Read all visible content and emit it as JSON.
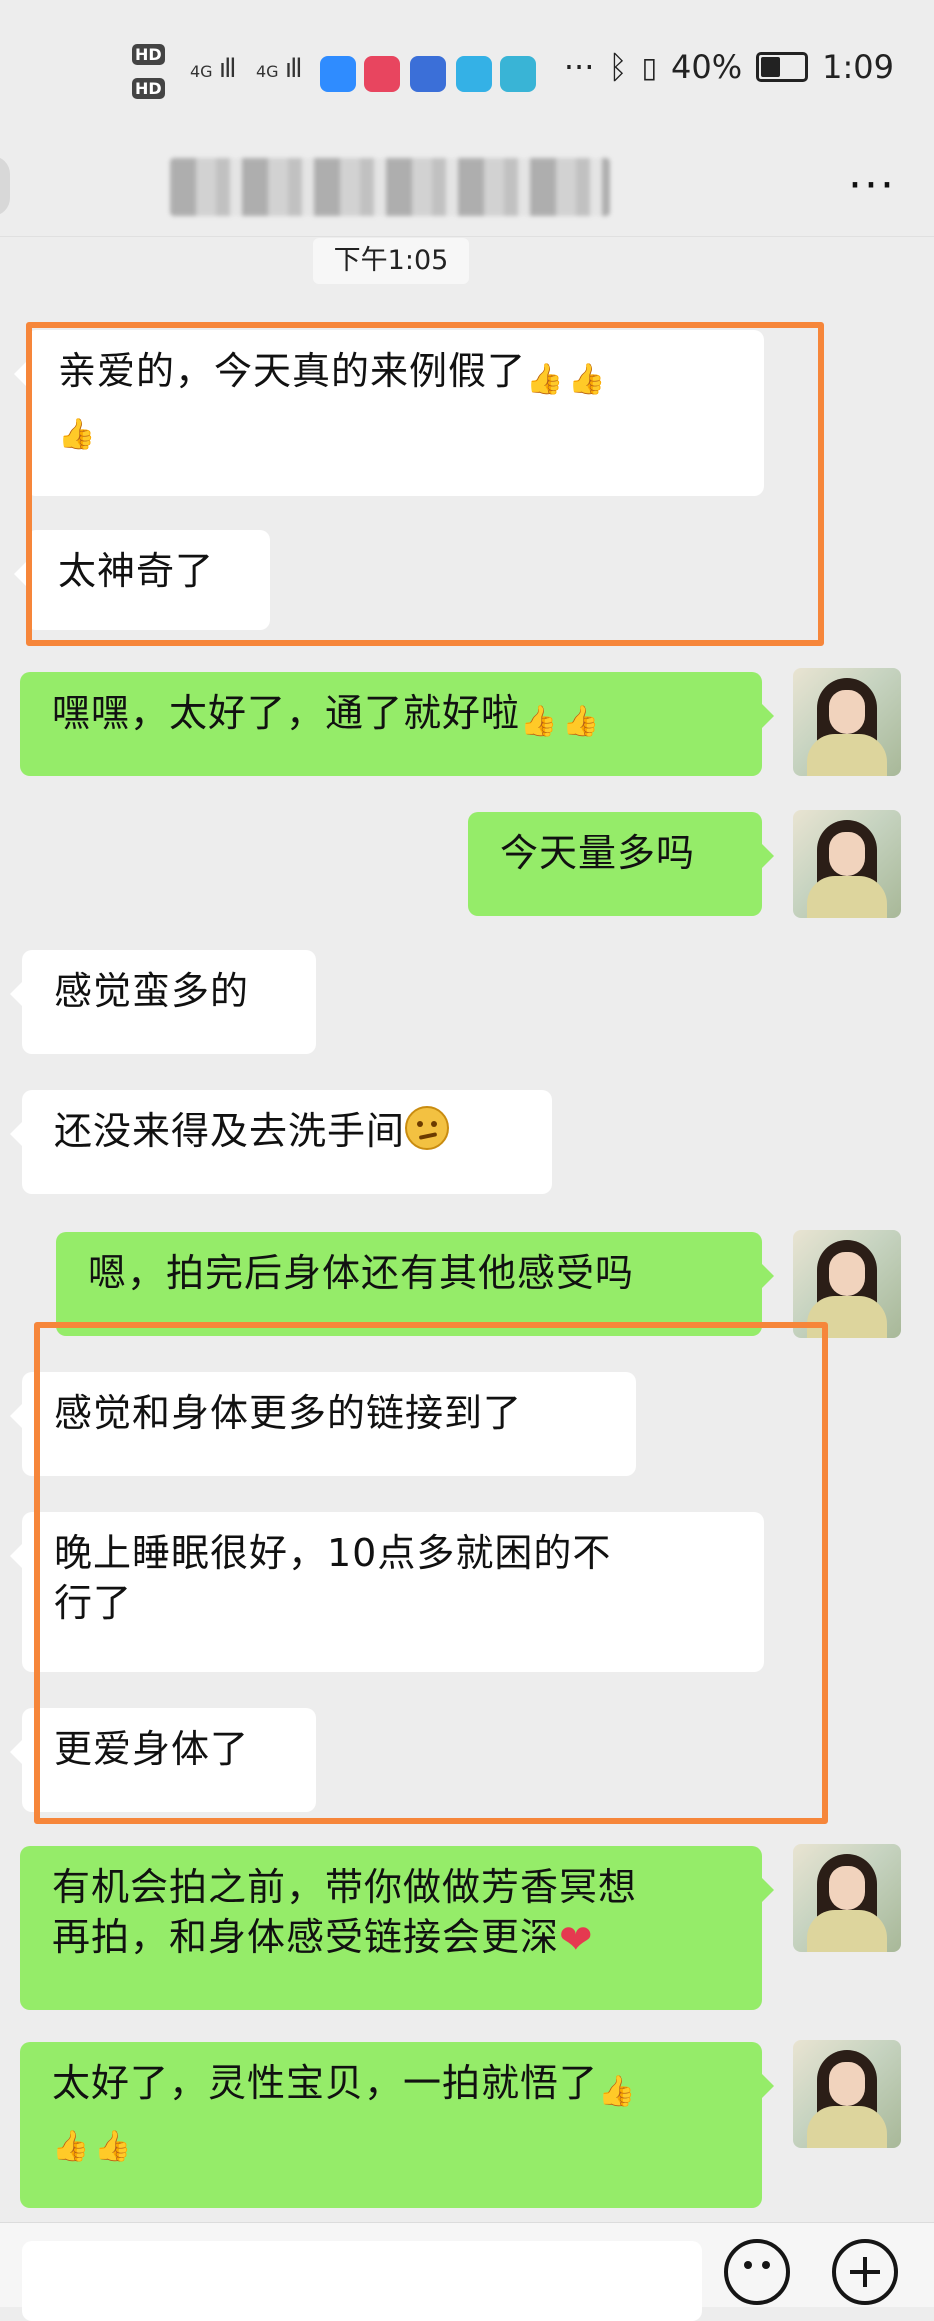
{
  "statusbar": {
    "sim1": "HD",
    "sim2": "HD",
    "net1": "4G",
    "net2": "4G",
    "more": "···",
    "battery_text": "40%",
    "time": "1:09"
  },
  "header": {
    "more": "···"
  },
  "chat": {
    "timestamp": "下午1:05",
    "messages": [
      {
        "side": "in",
        "text": "亲爱的，今天真的来例假了"
      },
      {
        "side": "in",
        "text": "太神奇了"
      },
      {
        "side": "out",
        "text": "嘿嘿，太好了，通了就好啦"
      },
      {
        "side": "out",
        "text": "今天量多吗"
      },
      {
        "side": "in",
        "text": "感觉蛮多的"
      },
      {
        "side": "in",
        "text": "还没来得及去洗手间"
      },
      {
        "side": "out",
        "text": "嗯，拍完后身体还有其他感受吗"
      },
      {
        "side": "in",
        "text": "感觉和身体更多的链接到了"
      },
      {
        "side": "in",
        "text_line1": "晚上睡眠很好，10点多就困的不",
        "text_line2": "行了"
      },
      {
        "side": "in",
        "text": "更爱身体了"
      },
      {
        "side": "out",
        "text_line1": "有机会拍之前，带你做做芳香冥想",
        "text_line2": "再拍，和身体感受链接会更深"
      },
      {
        "side": "out",
        "text": "太好了，灵性宝贝，一拍就悟了"
      }
    ]
  },
  "colors": {
    "incoming_bubble": "#ffffff",
    "outgoing_bubble": "#95ec69",
    "background": "#ededed",
    "highlight_box": "#f6863a"
  },
  "icons": [
    "thumbs-up-icon",
    "thinking-face-icon",
    "heart-icon",
    "emoji-icon",
    "plus-icon",
    "bluetooth-icon",
    "battery-icon"
  ]
}
